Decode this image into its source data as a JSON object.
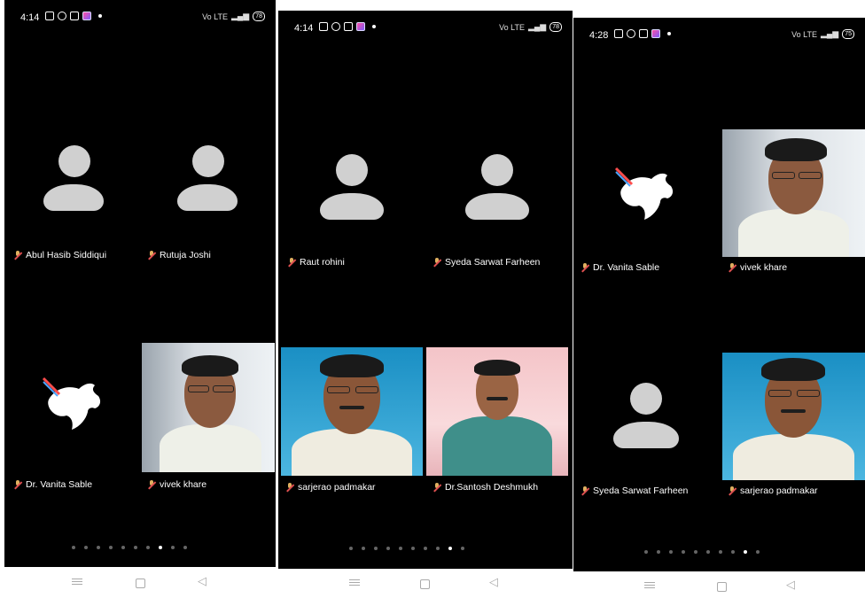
{
  "screens": [
    {
      "time": "4:14",
      "signal": "Vo LTE",
      "battery": "78",
      "participants": [
        "Abul Hasib Siddiqui",
        "Rutuja Joshi",
        "Dr. Vanita Sable",
        "vivek khare"
      ],
      "page_dots": 10,
      "active_dot": 7
    },
    {
      "time": "4:14",
      "signal": "Vo LTE",
      "battery": "78",
      "participants": [
        "Raut rohini",
        "Syeda Sarwat Farheen",
        "sarjerao padmakar",
        "Dr.Santosh Deshmukh"
      ],
      "page_dots": 10,
      "active_dot": 8
    },
    {
      "time": "4:28",
      "signal": "Vo LTE",
      "battery": "75",
      "participants": [
        "Dr. Vanita Sable",
        "vivek khare",
        "Syeda Sarwat Farheen",
        "sarjerao padmakar"
      ],
      "page_dots": 10,
      "active_dot": 8
    }
  ],
  "icons": {
    "mic_off": "mic-off-icon",
    "avatar": "person-placeholder-icon",
    "nav_back": "back-triangle-icon",
    "nav_home": "home-square-icon",
    "nav_recents": "recents-lines-icon"
  },
  "colors": {
    "background": "#000000",
    "placeholder": "#d0d0d0",
    "dot_active": "#ffffff",
    "dot_inactive": "#666666"
  }
}
